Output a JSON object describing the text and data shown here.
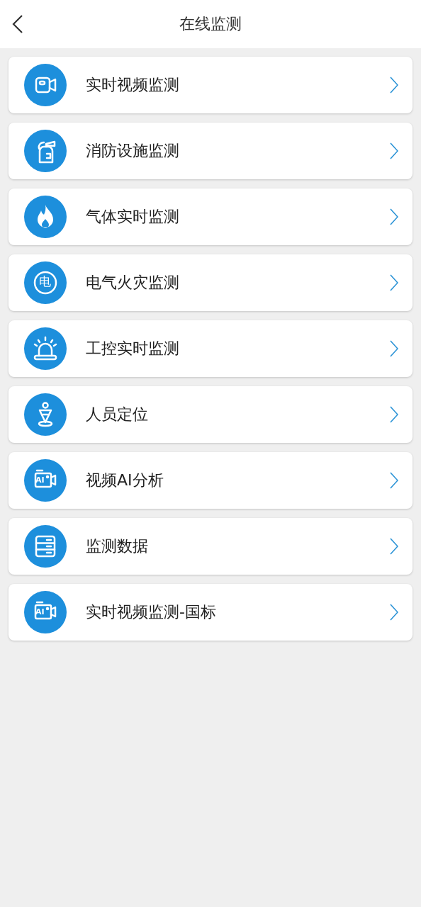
{
  "header": {
    "title": "在线监测"
  },
  "items": [
    {
      "kind": "video",
      "label": "实时视频监测"
    },
    {
      "kind": "extinguisher",
      "label": "消防设施监测"
    },
    {
      "kind": "flame",
      "label": "气体实时监测"
    },
    {
      "kind": "electric",
      "label": "电气火灾监测",
      "icon_text": "电"
    },
    {
      "kind": "alarm",
      "label": "工控实时监测"
    },
    {
      "kind": "location",
      "label": "人员定位"
    },
    {
      "kind": "ai-video",
      "label": "视频AI分析",
      "icon_text": "AI"
    },
    {
      "kind": "database",
      "label": "监测数据"
    },
    {
      "kind": "ai-video",
      "label": "实时视频监测-国标",
      "icon_text": "AI"
    }
  ]
}
